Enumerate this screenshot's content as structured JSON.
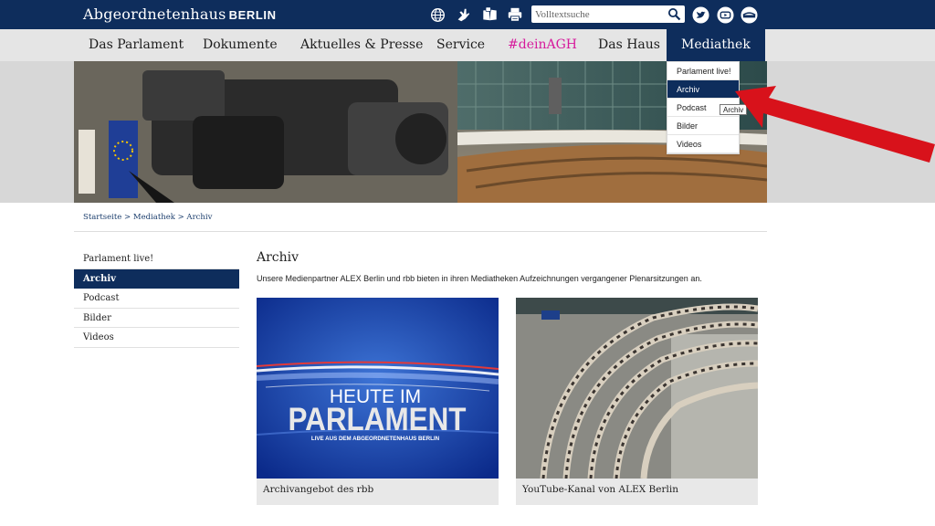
{
  "header": {
    "logo_text": "Abgeordnetenhaus",
    "logo_bold": "BERLIN",
    "icons": [
      "globe-icon",
      "sign-language-icon",
      "easy-read-book-icon",
      "print-icon",
      "twitter-icon",
      "youtube-icon",
      "instagram-icon"
    ],
    "search_placeholder": "Volltextsuche"
  },
  "nav": {
    "items": [
      "Das Parlament",
      "Dokumente",
      "Aktuelles & Presse",
      "Service",
      "#deinAGH",
      "Das Haus",
      "Mediathek"
    ],
    "active": "Mediathek"
  },
  "dropdown": {
    "items": [
      "Parlament live!",
      "Archiv",
      "Podcast",
      "Bilder",
      "Videos"
    ],
    "active": "Archiv",
    "tooltip": "Archiv"
  },
  "breadcrumb": "Startseite > Mediathek > Archiv",
  "sidebar": {
    "items": [
      "Parlament live!",
      "Archiv",
      "Podcast",
      "Bilder",
      "Videos"
    ],
    "active": "Archiv"
  },
  "main": {
    "title": "Archiv",
    "intro": "Unsere Medienpartner ALEX Berlin und rbb bieten in ihren Mediatheken Aufzeichnungen vergangener Plenarsitzungen an.",
    "cards": [
      {
        "caption": "Archivangebot des rbb",
        "image_line1": "HEUTE IM",
        "image_line2": "PARLAMENT",
        "image_line3": "LIVE AUS DEM ABGEORDNETENHAUS BERLIN"
      },
      {
        "caption": "YouTube-Kanal von ALEX Berlin"
      }
    ]
  },
  "colors": {
    "brand_navy": "#0e2d5c",
    "nav_bg": "#e5e5e5",
    "pink": "#d61a9c",
    "arrow_red": "#d8121b"
  }
}
